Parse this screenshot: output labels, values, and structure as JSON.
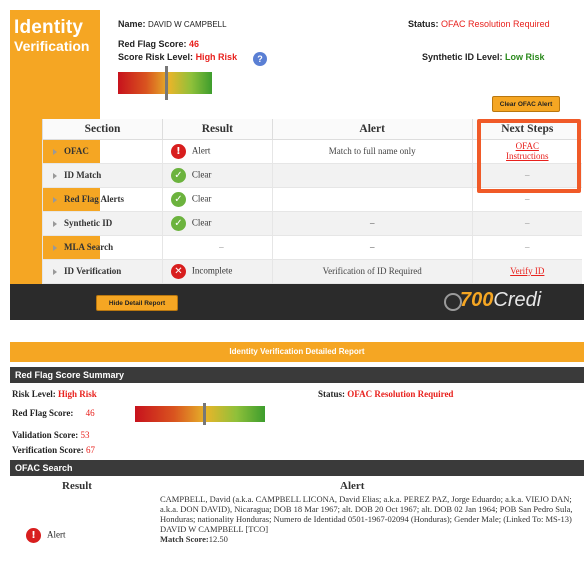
{
  "brand": {
    "line1": "Identity",
    "line2": "Verification"
  },
  "header": {
    "name_label": "Name:",
    "name_value": "DAVID W CAMPBELL",
    "red_flag_label": "Red Flag Score:",
    "red_flag_value": "46",
    "risk_level_label": "Score Risk Level:",
    "risk_level_value": "High Risk",
    "help_icon": "?",
    "status_label": "Status:",
    "status_value": "OFAC Resolution Required",
    "synthetic_label": "Synthetic ID Level:",
    "synthetic_value": "Low Risk",
    "clear_button": "Clear OFAC Alert",
    "red_flag_score_fraction": 0.46
  },
  "summary": {
    "columns": [
      "Section",
      "Result",
      "Alert",
      "Next Steps"
    ],
    "rows": [
      {
        "section": "OFAC",
        "result": "Alert",
        "icon": "alert-icon",
        "alert": "Match to full name only",
        "next_line1": "OFAC",
        "next_line2": "Instructions",
        "next_link": true
      },
      {
        "section": "ID Match",
        "result": "Clear",
        "icon": "check-icon",
        "alert": "",
        "next_line1": "–",
        "next_line2": "",
        "next_link": false
      },
      {
        "section": "Red Flag Alerts",
        "result": "Clear",
        "icon": "check-icon",
        "alert": "",
        "next_line1": "–",
        "next_line2": "",
        "next_link": false
      },
      {
        "section": "Synthetic ID",
        "result": "Clear",
        "icon": "check-icon",
        "alert": "–",
        "next_line1": "–",
        "next_line2": "",
        "next_link": false
      },
      {
        "section": "MLA Search",
        "result": "–",
        "icon": "",
        "alert": "–",
        "next_line1": "–",
        "next_line2": "",
        "next_link": false
      },
      {
        "section": "ID Verification",
        "result": "Incomplete",
        "icon": "x-icon",
        "alert": "Verification of ID Required",
        "next_line1": "Verify ID",
        "next_line2": "",
        "next_link": true
      }
    ]
  },
  "hide_button": "Hide Detail Report",
  "logo": {
    "part1": "700",
    "part2": "Credi"
  },
  "report": {
    "title": "Identity Verification Detailed Report",
    "red_flag_section": "Red Flag Score Summary",
    "risk_level_label": "Risk Level:",
    "risk_level_value": "High Risk",
    "status_label": "Status:",
    "status_value": "OFAC Resolution Required",
    "red_flag_label": "Red Flag Score:",
    "red_flag_value": "46",
    "validation_label": "Validation Score:",
    "validation_value": "53",
    "verification_label": "Verification Score:",
    "verification_value": "67",
    "ofac_section": "OFAC Search",
    "ofac_col_result": "Result",
    "ofac_col_alert": "Alert",
    "ofac_result": "Alert",
    "ofac_alert_text": "CAMPBELL, David (a.k.a. CAMPBELL LICONA, David Elias; a.k.a. PEREZ PAZ, Jorge Eduardo; a.k.a. VIEJO DAN; a.k.a. DON DAVID), Nicaragua; DOB 18 Mar 1967; alt. DOB 20 Oct 1967; alt. DOB 02 Jan 1964; POB San Pedro Sula, Honduras; nationality Honduras; Numero de Identidad 0501-1967-02094 (Honduras); Gender Male; (Linked To: MS-13)",
    "ofac_name_line": "DAVID W CAMPBELL [TCO]",
    "ofac_match_label": "Match Score:",
    "ofac_match_value": "12.50"
  }
}
